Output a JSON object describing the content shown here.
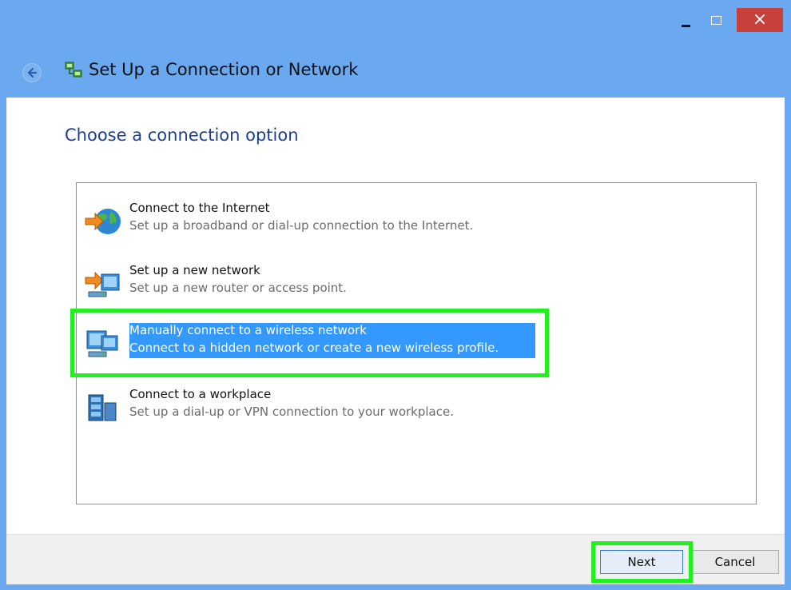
{
  "window": {
    "title": "Set Up a Connection or Network",
    "controls": {
      "minimize": "minimize",
      "maximize": "maximize",
      "close": "×"
    }
  },
  "page": {
    "heading": "Choose a connection option"
  },
  "options": [
    {
      "title": "Connect to the Internet",
      "description": "Set up a broadband or dial-up connection to the Internet.",
      "icon": "globe-connect-icon",
      "selected": false
    },
    {
      "title": "Set up a new network",
      "description": "Set up a new router or access point.",
      "icon": "router-icon",
      "selected": false
    },
    {
      "title": "Manually connect to a wireless network",
      "description": "Connect to a hidden network or create a new wireless profile.",
      "icon": "wireless-network-icon",
      "selected": true
    },
    {
      "title": "Connect to a workplace",
      "description": "Set up a dial-up or VPN connection to your workplace.",
      "icon": "workplace-icon",
      "selected": false
    }
  ],
  "footer": {
    "next_label": "Next",
    "cancel_label": "Cancel"
  },
  "colors": {
    "titlebar": "#6aa8f0",
    "heading": "#1c3f95",
    "selection": "#3399ff",
    "highlight_box": "#22ee22",
    "close_button": "#c8403a"
  }
}
